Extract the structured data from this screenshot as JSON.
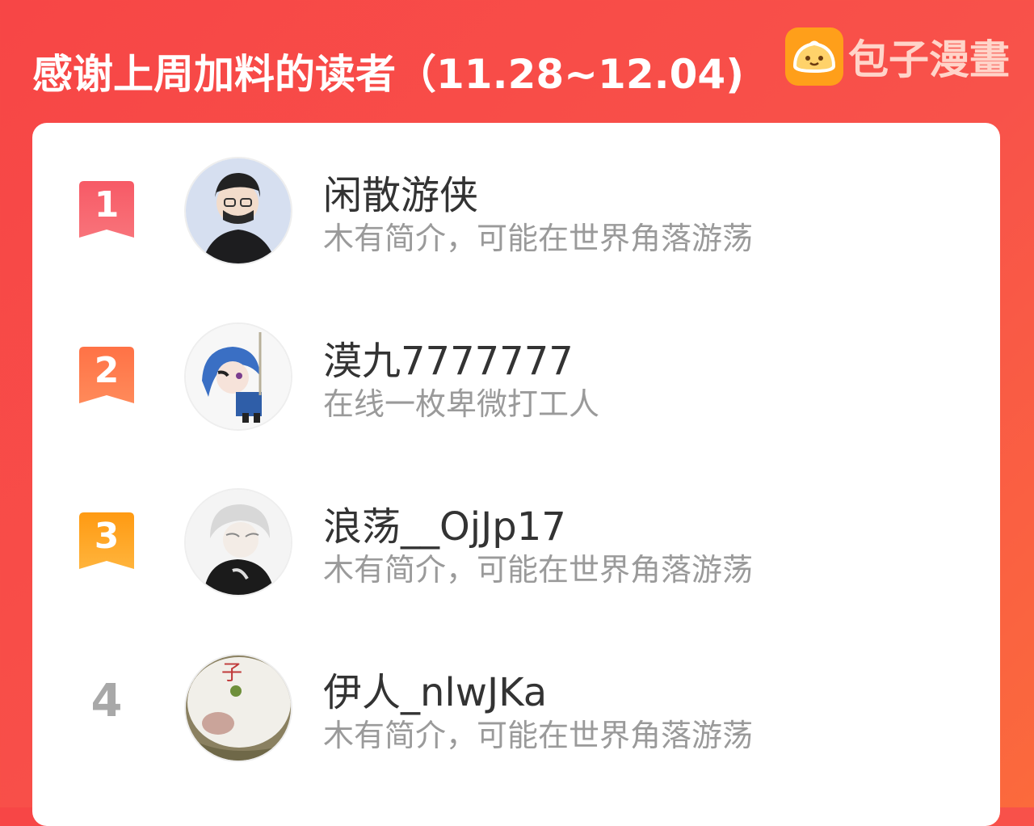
{
  "header": {
    "title": "感谢上周加料的读者（11.28~12.04)",
    "brand_name": "包子漫畫",
    "brand_icon": "bun-logo-icon"
  },
  "colors": {
    "background": "#f74646",
    "rank1": "#f4505c",
    "rank2": "#ff7a4a",
    "rank3": "#ff9f1a",
    "rank_plain": "#a8a8a8"
  },
  "readers": [
    {
      "rank": "1",
      "name": "闲散游侠",
      "bio": "木有简介，可能在世界角落游荡"
    },
    {
      "rank": "2",
      "name": "漠九7777777",
      "bio": "在线一枚卑微打工人"
    },
    {
      "rank": "3",
      "name": "浪荡__OjJp17",
      "bio": "木有简介，可能在世界角落游荡"
    },
    {
      "rank": "4",
      "name": "伊人_nlwJKa",
      "bio": "木有简介，可能在世界角落游荡"
    }
  ]
}
